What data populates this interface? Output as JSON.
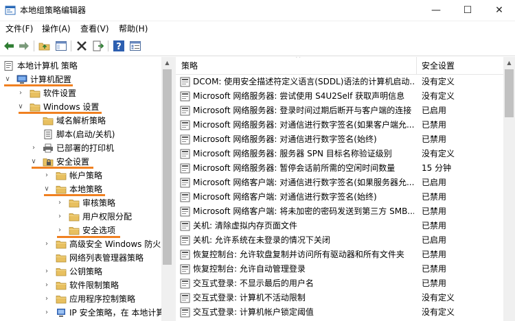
{
  "window": {
    "title": "本地组策略编辑器",
    "minimize_glyph": "—",
    "maximize_glyph": "☐",
    "close_glyph": "✕"
  },
  "menu": [
    {
      "label": "文件(F)"
    },
    {
      "label": "操作(A)"
    },
    {
      "label": "查看(V)"
    },
    {
      "label": "帮助(H)"
    }
  ],
  "toolbar": {
    "buttons": [
      "back-icon",
      "forward-icon",
      "up-folder-icon",
      "show-hide-tree-icon",
      "delete-icon",
      "export-list-icon",
      "help-icon",
      "properties-icon"
    ]
  },
  "tree": {
    "items": [
      {
        "label": "本地计算机 策略",
        "icon": "policy-computer-icon",
        "expander": ""
      },
      {
        "label": "计算机配置",
        "icon": "computer-icon",
        "expander": "∨"
      },
      {
        "label": "软件设置",
        "icon": "folder-icon",
        "expander": "›"
      },
      {
        "label": "Windows 设置",
        "icon": "folder-icon",
        "expander": "∨"
      },
      {
        "label": "域名解析策略",
        "icon": "folder-icon",
        "expander": ""
      },
      {
        "label": "脚本(启动/关机)",
        "icon": "script-icon",
        "expander": ""
      },
      {
        "label": "已部署的打印机",
        "icon": "printer-icon",
        "expander": "›"
      },
      {
        "label": "安全设置",
        "icon": "security-icon",
        "expander": "∨"
      },
      {
        "label": "帐户策略",
        "icon": "folder-icon",
        "expander": "›"
      },
      {
        "label": "本地策略",
        "icon": "folder-icon",
        "expander": "∨"
      },
      {
        "label": "审核策略",
        "icon": "folder-icon",
        "expander": "›"
      },
      {
        "label": "用户权限分配",
        "icon": "folder-icon",
        "expander": "›"
      },
      {
        "label": "安全选项",
        "icon": "folder-icon",
        "expander": "›"
      },
      {
        "label": "高级安全 Windows 防火",
        "icon": "folder-icon",
        "expander": "›"
      },
      {
        "label": "网络列表管理器策略",
        "icon": "folder-icon",
        "expander": ""
      },
      {
        "label": "公钥策略",
        "icon": "folder-icon",
        "expander": "›"
      },
      {
        "label": "软件限制策略",
        "icon": "folder-icon",
        "expander": "›"
      },
      {
        "label": "应用程序控制策略",
        "icon": "folder-icon",
        "expander": "›"
      },
      {
        "label": "IP 安全策略，在 本地计算",
        "icon": "ipsec-icon",
        "expander": "›"
      }
    ]
  },
  "list": {
    "headers": {
      "policy": "策略",
      "setting": "安全设置"
    },
    "rows": [
      {
        "policy": "DCOM: 使用安全描述符定义语言(SDDL)语法的计算机启动...",
        "setting": "没有定义"
      },
      {
        "policy": "Microsoft 网络服务器: 尝试使用 S4U2Self 获取声明信息",
        "setting": "没有定义"
      },
      {
        "policy": "Microsoft 网络服务器: 登录时间过期后断开与客户端的连接",
        "setting": "已启用"
      },
      {
        "policy": "Microsoft 网络服务器: 对通信进行数字签名(如果客户端允...",
        "setting": "已禁用"
      },
      {
        "policy": "Microsoft 网络服务器: 对通信进行数字签名(始终)",
        "setting": "已禁用"
      },
      {
        "policy": "Microsoft 网络服务器: 服务器 SPN 目标名称验证级别",
        "setting": "没有定义"
      },
      {
        "policy": "Microsoft 网络服务器: 暂停会话前所需的空闲时间数量",
        "setting": "15 分钟"
      },
      {
        "policy": "Microsoft 网络客户端: 对通信进行数字签名(如果服务器允...",
        "setting": "已启用"
      },
      {
        "policy": "Microsoft 网络客户端: 对通信进行数字签名(始终)",
        "setting": "已禁用"
      },
      {
        "policy": "Microsoft 网络客户端: 将未加密的密码发送到第三方 SMB...",
        "setting": "已禁用"
      },
      {
        "policy": "关机: 清除虚拟内存页面文件",
        "setting": "已禁用"
      },
      {
        "policy": "关机: 允许系统在未登录的情况下关闭",
        "setting": "已启用"
      },
      {
        "policy": "恢复控制台: 允许软盘复制并访问所有驱动器和所有文件夹",
        "setting": "已禁用"
      },
      {
        "policy": "恢复控制台: 允许自动管理登录",
        "setting": "已禁用"
      },
      {
        "policy": "交互式登录: 不显示最后的用户名",
        "setting": "已禁用"
      },
      {
        "policy": "交互式登录: 计算机不活动限制",
        "setting": "没有定义"
      },
      {
        "policy": "交互式登录: 计算机帐户锁定阈值",
        "setting": "没有定义"
      }
    ]
  },
  "colors": {
    "highlight_underline": "#f08020",
    "folder": "#e8c060"
  }
}
